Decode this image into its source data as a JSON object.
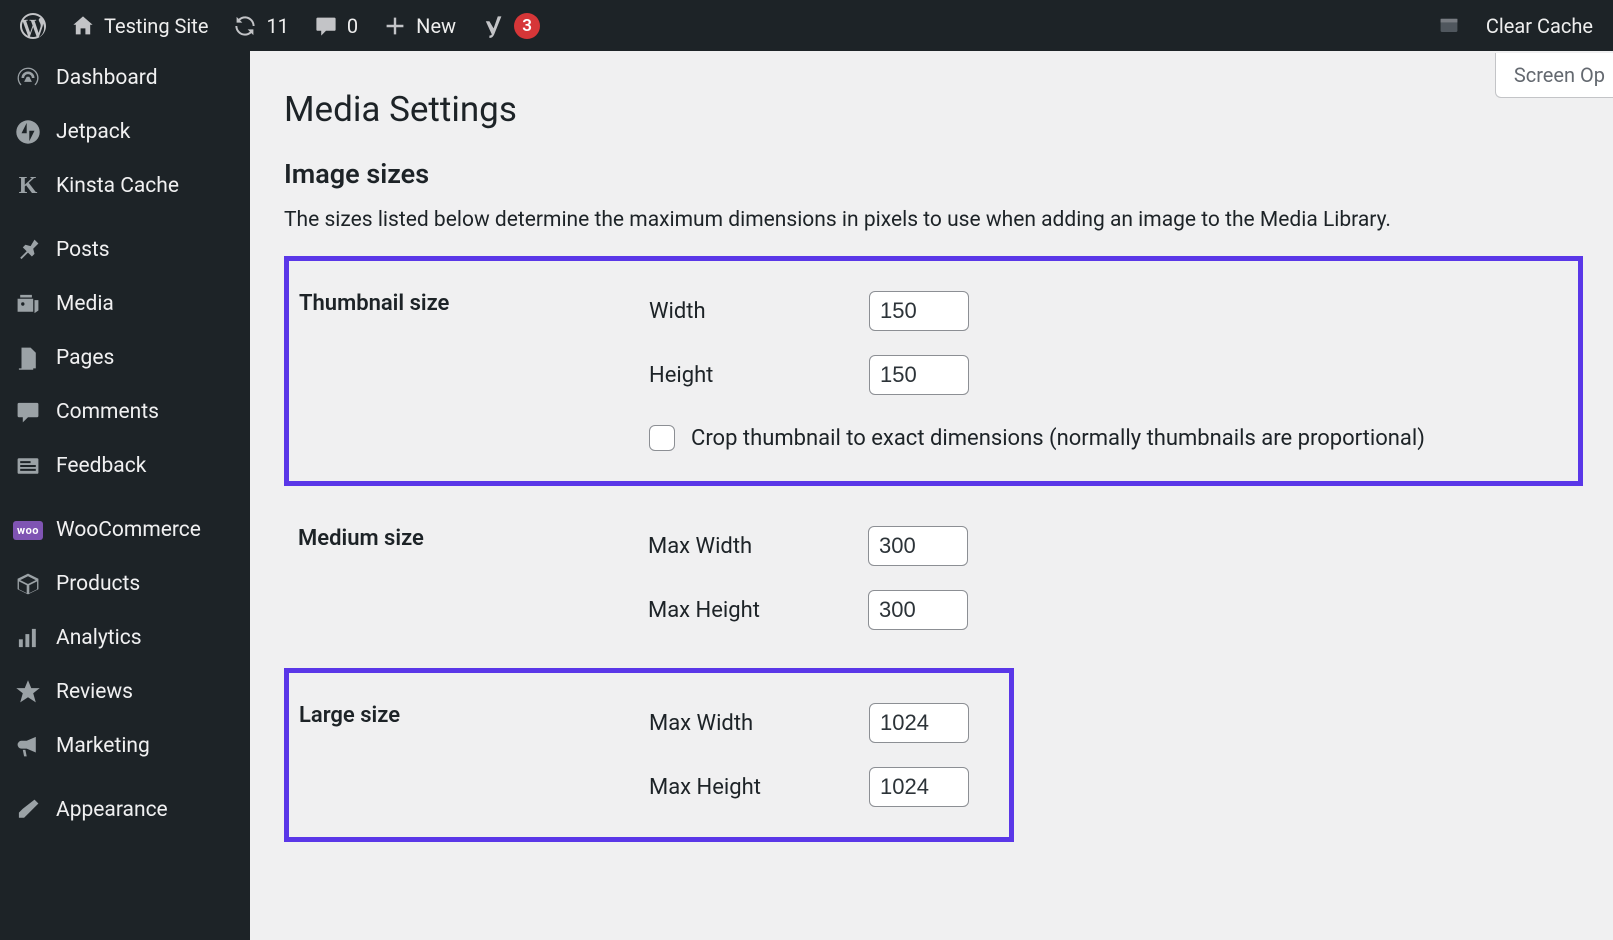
{
  "adminbar": {
    "site_name": "Testing Site",
    "updates_count": "11",
    "comments_count": "0",
    "new_label": "New",
    "yoast_badge": "3",
    "clear_cache": "Clear Cache"
  },
  "sidebar": {
    "items": [
      {
        "label": "Dashboard"
      },
      {
        "label": "Jetpack"
      },
      {
        "label": "Kinsta Cache"
      },
      {
        "label": "Posts"
      },
      {
        "label": "Media"
      },
      {
        "label": "Pages"
      },
      {
        "label": "Comments"
      },
      {
        "label": "Feedback"
      },
      {
        "label": "WooCommerce"
      },
      {
        "label": "Products"
      },
      {
        "label": "Analytics"
      },
      {
        "label": "Reviews"
      },
      {
        "label": "Marketing"
      },
      {
        "label": "Appearance"
      }
    ]
  },
  "screen_options": "Screen Op",
  "page": {
    "title": "Media Settings",
    "section_heading": "Image sizes",
    "description": "The sizes listed below determine the maximum dimensions in pixels to use when adding an image to the Media Library.",
    "thumbnail": {
      "heading": "Thumbnail size",
      "width_label": "Width",
      "width_value": "150",
      "height_label": "Height",
      "height_value": "150",
      "crop_label": "Crop thumbnail to exact dimensions (normally thumbnails are proportional)"
    },
    "medium": {
      "heading": "Medium size",
      "max_width_label": "Max Width",
      "max_width_value": "300",
      "max_height_label": "Max Height",
      "max_height_value": "300"
    },
    "large": {
      "heading": "Large size",
      "max_width_label": "Max Width",
      "max_width_value": "1024",
      "max_height_label": "Max Height",
      "max_height_value": "1024"
    }
  }
}
